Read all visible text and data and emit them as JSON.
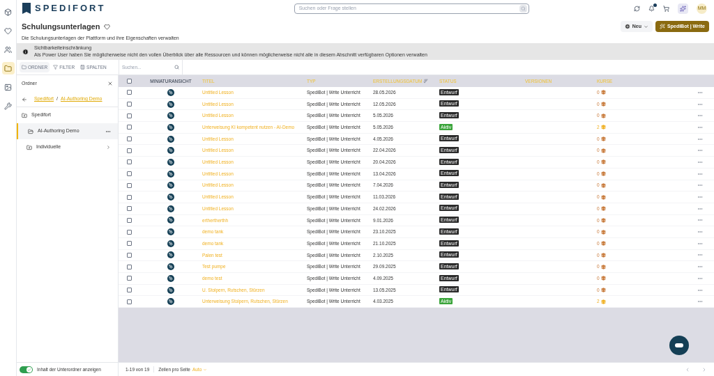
{
  "nav_rail": [
    {
      "selected": false
    },
    {
      "selected": false
    },
    {
      "selected": false
    },
    {
      "selected": true
    },
    {
      "selected": false
    },
    {
      "selected": false
    }
  ],
  "header": {
    "brand": "SPEDIFORT",
    "search": {
      "placeholder": "Suchen oder Frage stellen"
    },
    "avatar": "MM"
  },
  "page": {
    "title": "Schulungsunterlagen",
    "subtitle": "Die Schulungsunterlagen der Plattform und ihre Eigenschaften verwalten",
    "buttons": [
      "Neu",
      "SpediBot | Write"
    ]
  },
  "banner": {
    "title": "Sichtbarkeiteinschränkung",
    "text": "Als Power User haben Sie möglicherweise nicht den vollen Überblick über alle Ressourcen und können möglicherweise nicht alle in diesem Abschnitt verfügbaren Optionen verwalten"
  },
  "toolbar": {
    "tabs": [
      {
        "label": "ORDNER",
        "selected": true
      },
      {
        "label": "FILTER",
        "selected": false
      },
      {
        "label": "SPALTEN",
        "selected": false
      }
    ],
    "search": {
      "placeholder": "Suchen..."
    }
  },
  "folders": {
    "title": "Ordner",
    "breadcrumb": [
      "Spedifort",
      "AI-Authoring Demo"
    ],
    "separator": "/",
    "items": [
      {
        "label": "Spedifort",
        "selected": false,
        "kind": "root"
      },
      {
        "label": "AI-Authoring Demo",
        "selected": true,
        "kind": "open"
      },
      {
        "label": "Individuelle",
        "selected": false,
        "kind": "closed"
      }
    ],
    "toggle": {
      "label": "Inhalt der Unterordner anzeigen",
      "on": true
    }
  },
  "table": {
    "select_all": false,
    "columns": [
      "MINIATURANSICHT",
      "TITEL",
      "TYP",
      "ERSTELLUNGSDATUM",
      "STATUS",
      "VERSIONEN",
      "KURSE"
    ],
    "rows": [
      {
        "checked": false,
        "title": "Untitled Lesson",
        "type": "SpediBot | Write Unterricht",
        "date": "28.05.2026",
        "status": "Entwurf",
        "kind": "draft",
        "courses": "0"
      },
      {
        "checked": false,
        "title": "Untitled Lesson",
        "type": "SpediBot | Write Unterricht",
        "date": "12.05.2026",
        "status": "Entwurf",
        "kind": "draft",
        "courses": "0"
      },
      {
        "checked": false,
        "title": "Untitled Lesson",
        "type": "SpediBot | Write Unterricht",
        "date": "5.05.2026",
        "status": "Entwurf",
        "kind": "draft",
        "courses": "0"
      },
      {
        "checked": false,
        "title": "Unterweisung KI kompetent nutzen - AI-Demo",
        "type": "SpediBot | Write Unterricht",
        "date": "5.05.2026",
        "status": "Aktiv",
        "kind": "active",
        "courses": "2"
      },
      {
        "checked": false,
        "title": "Untitled Lesson",
        "type": "SpediBot | Write Unterricht",
        "date": "4.05.2026",
        "status": "Entwurf",
        "kind": "draft",
        "courses": "0"
      },
      {
        "checked": false,
        "title": "Untitled Lesson",
        "type": "SpediBot | Write Unterricht",
        "date": "22.04.2026",
        "status": "Entwurf",
        "kind": "draft",
        "courses": "0"
      },
      {
        "checked": false,
        "title": "Untitled Lesson",
        "type": "SpediBot | Write Unterricht",
        "date": "20.04.2026",
        "status": "Entwurf",
        "kind": "draft",
        "courses": "0"
      },
      {
        "checked": false,
        "title": "Untitled Lesson",
        "type": "SpediBot | Write Unterricht",
        "date": "13.04.2026",
        "status": "Entwurf",
        "kind": "draft",
        "courses": "0"
      },
      {
        "checked": false,
        "title": "Untitled Lesson",
        "type": "SpediBot | Write Unterricht",
        "date": "7.04.2026",
        "status": "Entwurf",
        "kind": "draft",
        "courses": "0"
      },
      {
        "checked": false,
        "title": "Untitled Lesson",
        "type": "SpediBot | Write Unterricht",
        "date": "11.03.2026",
        "status": "Entwurf",
        "kind": "draft",
        "courses": "0"
      },
      {
        "checked": false,
        "title": "Untitled Lesson",
        "type": "SpediBot | Write Unterricht",
        "date": "24.02.2026",
        "status": "Entwurf",
        "kind": "draft",
        "courses": "0"
      },
      {
        "checked": false,
        "title": "erthertherthh",
        "type": "SpediBot | Write Unterricht",
        "date": "9.01.2026",
        "status": "Entwurf",
        "kind": "draft",
        "courses": "0"
      },
      {
        "checked": false,
        "title": "demo tank",
        "type": "SpediBot | Write Unterricht",
        "date": "23.10.2025",
        "status": "Entwurf",
        "kind": "draft",
        "courses": "0"
      },
      {
        "checked": false,
        "title": "demo tank",
        "type": "SpediBot | Write Unterricht",
        "date": "21.10.2025",
        "status": "Entwurf",
        "kind": "draft",
        "courses": "0"
      },
      {
        "checked": false,
        "title": "Palen test",
        "type": "SpediBot | Write Unterricht",
        "date": "2.10.2025",
        "status": "Entwurf",
        "kind": "draft",
        "courses": "0"
      },
      {
        "checked": false,
        "title": "Test pumpe",
        "type": "SpediBot | Write Unterricht",
        "date": "29.09.2025",
        "status": "Entwurf",
        "kind": "draft",
        "courses": "0"
      },
      {
        "checked": false,
        "title": "demo test",
        "type": "SpediBot | Write Unterricht",
        "date": "4.09.2025",
        "status": "Entwurf",
        "kind": "draft",
        "courses": "0"
      },
      {
        "checked": false,
        "title": "U. Stolpern, Rutschen, Stürzen",
        "type": "SpediBot | Write Unterricht",
        "date": "13.05.2025",
        "status": "Entwurf",
        "kind": "draft",
        "courses": "0"
      },
      {
        "checked": false,
        "title": "Unterweisung Stolpern, Rutschen, Stürzen",
        "type": "SpediBot | Write Unterricht",
        "date": "4.03.2025",
        "status": "Aktiv",
        "kind": "active",
        "courses": "2"
      }
    ]
  },
  "footer": {
    "range": "1-19 von 19",
    "rows_label": "Zeilen pro Seite",
    "rows_value": "Auto"
  }
}
